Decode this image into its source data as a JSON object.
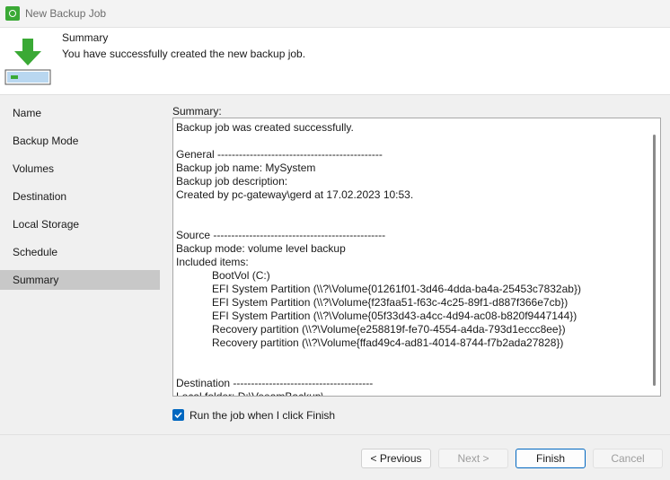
{
  "window": {
    "title": "New Backup Job"
  },
  "header": {
    "title": "Summary",
    "subtitle": "You have successfully created the new backup job."
  },
  "sidebar": {
    "items": [
      {
        "label": "Name",
        "active": false
      },
      {
        "label": "Backup Mode",
        "active": false
      },
      {
        "label": "Volumes",
        "active": false
      },
      {
        "label": "Destination",
        "active": false
      },
      {
        "label": "Local Storage",
        "active": false
      },
      {
        "label": "Schedule",
        "active": false
      },
      {
        "label": "Summary",
        "active": true
      }
    ]
  },
  "summary": {
    "label": "Summary:",
    "text": "Backup job was created successfully.\n\nGeneral ----------------------------------------------\nBackup job name: MySystem\nBackup job description:\nCreated by pc-gateway\\gerd at 17.02.2023 10:53.\n\n\nSource ------------------------------------------------\nBackup mode: volume level backup\nIncluded items:\n            BootVol (C:)\n            EFI System Partition (\\\\?\\Volume{01261f01-3d46-4dda-ba4a-25453c7832ab})\n            EFI System Partition (\\\\?\\Volume{f23faa51-f63c-4c25-89f1-d887f366e7cb})\n            EFI System Partition (\\\\?\\Volume{05f33d43-a4cc-4d94-ac08-b820f9447144})\n            Recovery partition (\\\\?\\Volume{e258819f-fe70-4554-a4da-793d1eccc8ee})\n            Recovery partition (\\\\?\\Volume{ffad49c4-ad81-4014-8744-f7b2ada27828})\n\n\nDestination ---------------------------------------\nLocal folder: D:\\VeeamBackup\\"
  },
  "run_on_finish": {
    "label": "Run the job when I click Finish",
    "checked": true
  },
  "buttons": {
    "previous": "< Previous",
    "next": "Next >",
    "finish": "Finish",
    "cancel": "Cancel"
  },
  "colors": {
    "accent": "#0067c0",
    "active_item": "#c8c8c8",
    "icon_green": "#3aa935"
  },
  "icons": {
    "app": "veeam-gear-icon",
    "wizard": "download-arrow-drive-icon",
    "check": "checkmark-icon"
  }
}
